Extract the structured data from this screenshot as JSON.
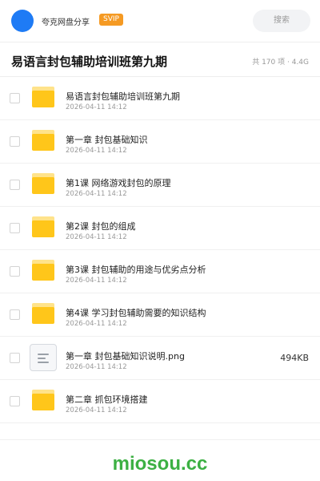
{
  "header": {
    "owner_name": "夸克网盘分享",
    "badge": "SVIP",
    "search_label": "搜索",
    "avatar_color": "#1e7bf5"
  },
  "folder": {
    "title": "易语言封包辅助培训班第九期",
    "meta": "共 170 项 · 4.4G"
  },
  "items": [
    {
      "type": "folder",
      "icon": "folder-icon",
      "name": "易语言封包辅助培训班第九期",
      "date": "2026-04-11 14:12",
      "size": ""
    },
    {
      "type": "folder",
      "icon": "folder-icon",
      "name": "第一章 封包基础知识",
      "date": "2026-04-11 14:12",
      "size": ""
    },
    {
      "type": "folder",
      "icon": "folder-icon",
      "name": "第1课 网络游戏封包的原理",
      "date": "2026-04-11 14:12",
      "size": ""
    },
    {
      "type": "folder",
      "icon": "folder-icon",
      "name": "第2课 封包的组成",
      "date": "2026-04-11 14:12",
      "size": ""
    },
    {
      "type": "folder",
      "icon": "folder-icon",
      "name": "第3课 封包辅助的用途与优劣点分析",
      "date": "2026-04-11 14:12",
      "size": ""
    },
    {
      "type": "folder",
      "icon": "folder-icon",
      "name": "第4课 学习封包辅助需要的知识结构",
      "date": "2026-04-11 14:12",
      "size": ""
    },
    {
      "type": "file",
      "icon": "document-icon",
      "name": "第一章 封包基础知识说明.png",
      "date": "2026-04-11 14:12",
      "size": "494KB"
    },
    {
      "type": "folder",
      "icon": "folder-icon",
      "name": "第二章 抓包环境搭建",
      "date": "2026-04-11 14:12",
      "size": ""
    }
  ],
  "footer": {
    "watermark": "miosou.cc",
    "watermark_color": "#3cb043"
  }
}
